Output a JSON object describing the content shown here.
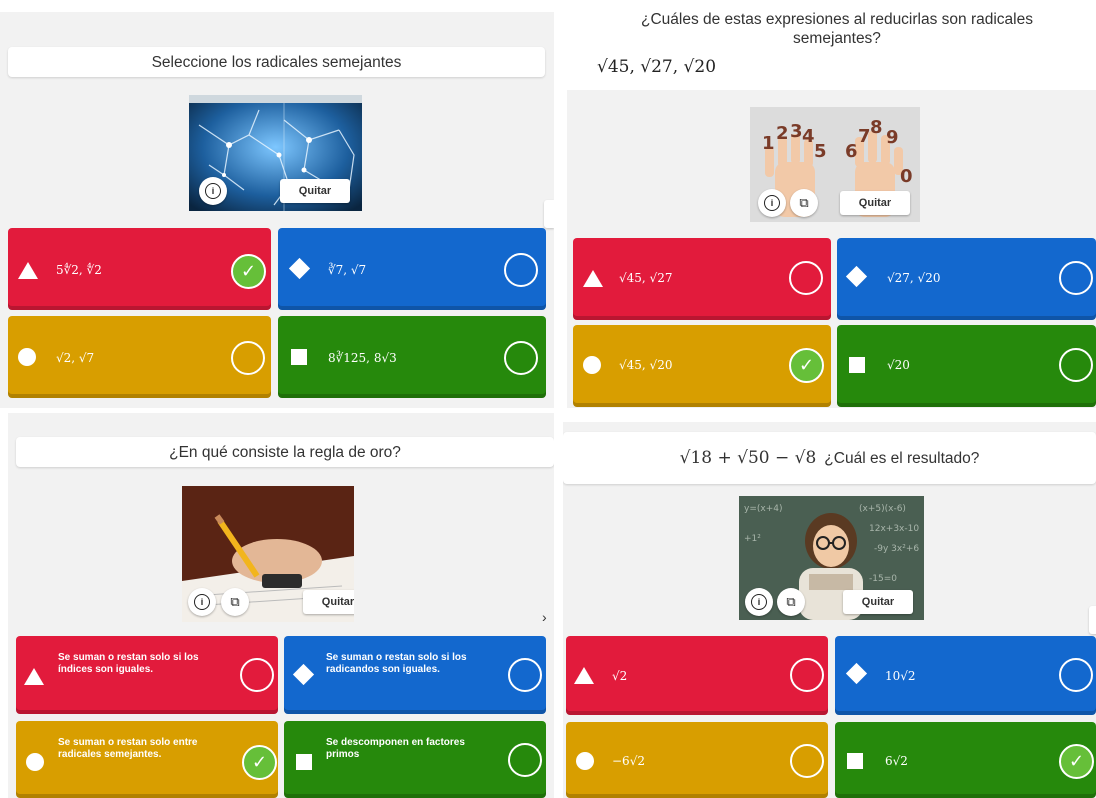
{
  "common": {
    "quitar_label": "Quitar",
    "info_icon": "info-icon",
    "crop_icon": "crop-icon"
  },
  "panel1": {
    "question": "Seleccione los radicales semejantes",
    "answers": [
      {
        "color": "red",
        "shape": "triangle",
        "text": "5∜2, ∜2",
        "state": "correct"
      },
      {
        "color": "blue",
        "shape": "diamond",
        "text": "∛7, √7",
        "state": "empty"
      },
      {
        "color": "yellow",
        "shape": "circle",
        "text": "√2, √7",
        "state": "empty"
      },
      {
        "color": "green",
        "shape": "square",
        "text": "8∛125, 8√3",
        "state": "empty"
      }
    ]
  },
  "panel2": {
    "question": "¿Cuáles de estas expresiones al reducirlas son radicales semejantes?",
    "question_math": "√45, √27, √20",
    "answers": [
      {
        "color": "red",
        "shape": "triangle",
        "text": "√45, √27",
        "state": "empty"
      },
      {
        "color": "blue",
        "shape": "diamond",
        "text": "√27, √20",
        "state": "empty"
      },
      {
        "color": "yellow",
        "shape": "circle",
        "text": "√45, √20",
        "state": "correct"
      },
      {
        "color": "green",
        "shape": "square",
        "text": "√20",
        "state": "empty"
      }
    ]
  },
  "panel3": {
    "question": "¿En qué consiste la regla de oro?",
    "answers": [
      {
        "color": "red",
        "shape": "triangle",
        "text": "Se suman o restan solo si los índices son iguales.",
        "state": "empty"
      },
      {
        "color": "blue",
        "shape": "diamond",
        "text": "Se suman o restan solo si los radicandos son iguales.",
        "state": "empty"
      },
      {
        "color": "yellow",
        "shape": "circle",
        "text": "Se suman o restan solo entre radicales semejantes.",
        "state": "correct"
      },
      {
        "color": "green",
        "shape": "square",
        "text": "Se descomponen en factores primos",
        "state": "empty"
      }
    ]
  },
  "panel4": {
    "question_math": "√18 + √50 − √8",
    "question": "¿Cuál es el resultado?",
    "answers": [
      {
        "color": "red",
        "shape": "triangle",
        "text": "√2",
        "state": "empty"
      },
      {
        "color": "blue",
        "shape": "diamond",
        "text": "10√2",
        "state": "empty"
      },
      {
        "color": "yellow",
        "shape": "circle",
        "text": "−6√2",
        "state": "empty"
      },
      {
        "color": "green",
        "shape": "square",
        "text": "6√2",
        "state": "correct"
      }
    ],
    "arrow_glyph": "›"
  }
}
